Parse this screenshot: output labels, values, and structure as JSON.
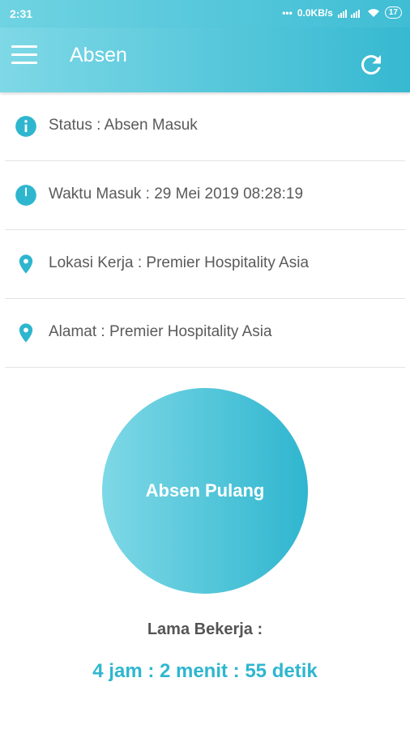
{
  "statusbar": {
    "time": "2:31",
    "network_speed": "0.0KB/s",
    "battery": "17"
  },
  "appbar": {
    "title": "Absen"
  },
  "info": {
    "status": "Status : Absen Masuk",
    "waktu_masuk": "Waktu Masuk : 29 Mei 2019 08:28:19",
    "lokasi_kerja": "Lokasi Kerja : Premier Hospitality Asia",
    "alamat": "Alamat : Premier Hospitality Asia"
  },
  "action": {
    "button_label": "Absen Pulang"
  },
  "duration": {
    "label": "Lama Bekerja :",
    "value": "4 jam : 2 menit : 55 detik"
  },
  "colors": {
    "accent": "#2fb6cf",
    "accent_light": "#7ed8e6"
  }
}
